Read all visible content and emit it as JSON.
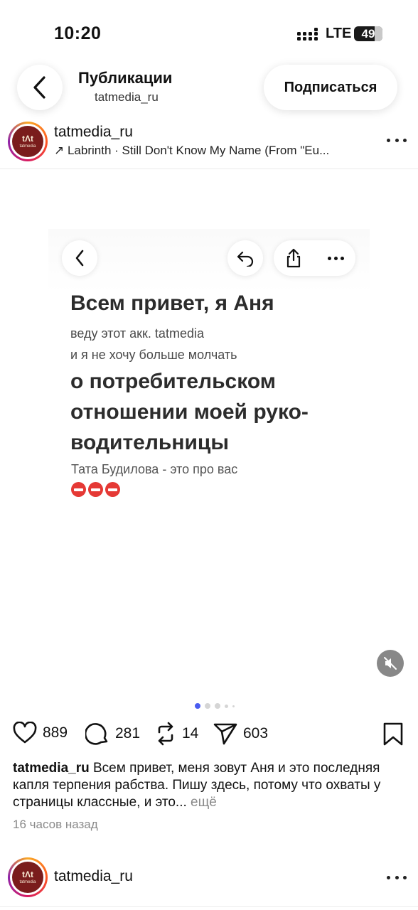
{
  "status_bar": {
    "time": "10:20",
    "network": "LTE",
    "battery": "49"
  },
  "header": {
    "title": "Публикации",
    "subtitle": "tatmedia_ru",
    "follow_label": "Подписаться"
  },
  "avatar": {
    "text": "tɅt",
    "small": "tatmedia"
  },
  "post": {
    "username": "tatmedia_ru",
    "music": "↗ Labrinth · Still Don't Know My Name (From \"Eu...",
    "image": {
      "heading": "Всем привет, я Аня",
      "line1": "веду этот акк. tatmedia",
      "line2": "и я не хочу больше молчать",
      "bold_line1": "о потребительском",
      "bold_line2": "отношении моей руко-",
      "bold_line3": "водительницы",
      "footer": "Тата Будилова - это про вас"
    },
    "carousel": {
      "total": 5,
      "active": 1
    },
    "likes": "889",
    "comments": "281",
    "reposts": "14",
    "shares": "603",
    "caption_user": "tatmedia_ru",
    "caption_text": " Всем привет, меня зовут Аня и это последняя капля терпения рабства. Пишу здесь, потому что охваты у страницы классные, и это...",
    "caption_more": " ещё",
    "time_ago": "16 часов назад"
  },
  "next_post": {
    "username": "tatmedia_ru"
  },
  "icons": [
    "chevron-left-icon",
    "more-icon",
    "reply-icon",
    "share-icon",
    "mute-icon",
    "heart-icon",
    "comment-icon",
    "repost-icon",
    "send-icon",
    "bookmark-icon",
    "stop-sign-icon"
  ],
  "colors": {
    "accent_dot": "#4a5cf0",
    "avatar_bg": "#7a1c1c",
    "stop_red": "#e53935"
  }
}
